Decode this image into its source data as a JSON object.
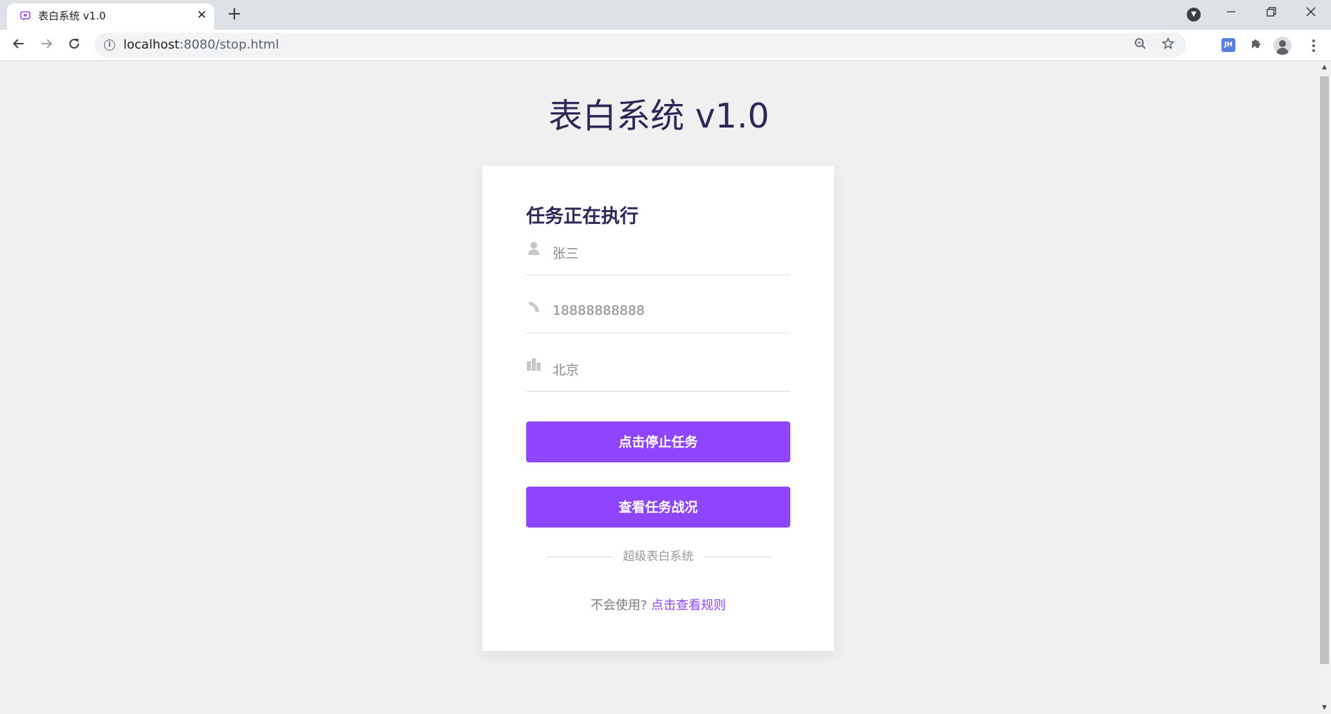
{
  "browser": {
    "tab_title": "表白系统 v1.0",
    "tab_close": "✕",
    "new_tab": "+",
    "url_host": "localhost",
    "url_path": ":8080/stop.html"
  },
  "page": {
    "title": "表白系统 v1.0"
  },
  "card": {
    "heading": "任务正在执行",
    "fields": {
      "name": {
        "value": "张三",
        "icon": "user-icon"
      },
      "phone": {
        "value": "18888888888",
        "icon": "phone-icon"
      },
      "city": {
        "value": "北京",
        "icon": "building-icon"
      }
    },
    "stop_button": "点击停止任务",
    "status_button": "查看任务战况",
    "divider_text": "超级表白系统",
    "help_prefix": "不会使用?",
    "help_link": "点击查看规则"
  },
  "colors": {
    "accent": "#8f44fd",
    "title": "#2e2757",
    "background": "#f0f0f0"
  }
}
